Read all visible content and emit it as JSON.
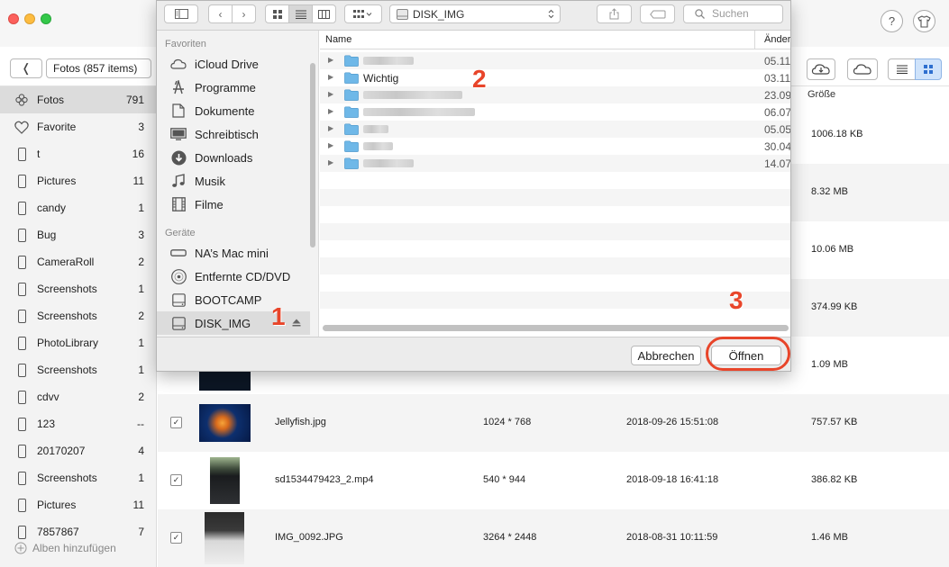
{
  "app": {
    "help_label": "?",
    "album_title": "Fotos (857 items)"
  },
  "sidebar": {
    "items": [
      {
        "label": "Fotos",
        "count": "791",
        "icon": "photos-icon"
      },
      {
        "label": "Favorite",
        "count": "3",
        "icon": "heart-icon"
      },
      {
        "label": "t",
        "count": "16",
        "icon": "phone-icon"
      },
      {
        "label": "Pictures",
        "count": "11",
        "icon": "phone-icon"
      },
      {
        "label": "candy",
        "count": "1",
        "icon": "phone-icon"
      },
      {
        "label": "Bug",
        "count": "3",
        "icon": "phone-icon"
      },
      {
        "label": "CameraRoll",
        "count": "2",
        "icon": "phone-icon"
      },
      {
        "label": "Screenshots",
        "count": "1",
        "icon": "phone-icon"
      },
      {
        "label": "Screenshots",
        "count": "2",
        "icon": "phone-icon"
      },
      {
        "label": "PhotoLibrary",
        "count": "1",
        "icon": "phone-icon"
      },
      {
        "label": "Screenshots",
        "count": "1",
        "icon": "phone-icon"
      },
      {
        "label": "cdvv",
        "count": "2",
        "icon": "phone-icon"
      },
      {
        "label": "123",
        "count": "--",
        "icon": "phone-icon"
      },
      {
        "label": "20170207",
        "count": "4",
        "icon": "phone-icon"
      },
      {
        "label": "Screenshots",
        "count": "1",
        "icon": "phone-icon"
      },
      {
        "label": "Pictures",
        "count": "11",
        "icon": "phone-icon"
      },
      {
        "label": "7857867",
        "count": "7",
        "icon": "phone-icon"
      }
    ],
    "add_album": "Alben hinzufügen"
  },
  "list": {
    "size_header": "Größe",
    "rows": [
      {
        "name": "",
        "resolution": "",
        "date": "",
        "size": "1006.18 KB",
        "checked": false
      },
      {
        "name": "",
        "resolution": "",
        "date": "",
        "size": "8.32 MB",
        "checked": false
      },
      {
        "name": "",
        "resolution": "",
        "date": "",
        "size": "10.06 MB",
        "checked": false
      },
      {
        "name": "",
        "resolution": "",
        "date": "",
        "size": "374.99 KB",
        "checked": false
      },
      {
        "name": "",
        "resolution": "",
        "date": "",
        "size": "1.09 MB",
        "checked": false
      },
      {
        "name": "Jellyfish.jpg",
        "resolution": "1024 * 768",
        "date": "2018-09-26 15:51:08",
        "size": "757.57 KB",
        "checked": true
      },
      {
        "name": "sd1534479423_2.mp4",
        "resolution": "540 * 944",
        "date": "2018-09-18 16:41:18",
        "size": "386.82 KB",
        "checked": true
      },
      {
        "name": "IMG_0092.JPG",
        "resolution": "3264 * 2448",
        "date": "2018-08-31 10:11:59",
        "size": "1.46 MB",
        "checked": true
      }
    ]
  },
  "dialog": {
    "path": "DISK_IMG",
    "search_placeholder": "Suchen",
    "favorites_header": "Favoriten",
    "favorites": [
      {
        "label": "iCloud Drive",
        "icon": "cloud-icon"
      },
      {
        "label": "Programme",
        "icon": "apps-icon"
      },
      {
        "label": "Dokumente",
        "icon": "document-icon"
      },
      {
        "label": "Schreibtisch",
        "icon": "desktop-icon"
      },
      {
        "label": "Downloads",
        "icon": "download-icon"
      },
      {
        "label": "Musik",
        "icon": "music-icon"
      },
      {
        "label": "Filme",
        "icon": "film-icon"
      }
    ],
    "devices_header": "Geräte",
    "devices": [
      {
        "label": "NA’s Mac mini",
        "icon": "computer-icon"
      },
      {
        "label": "Entfernte CD/DVD",
        "icon": "disc-icon"
      },
      {
        "label": "BOOTCAMP",
        "icon": "drive-icon"
      },
      {
        "label": "DISK_IMG",
        "icon": "drive-icon"
      }
    ],
    "col_name": "Name",
    "col_changed": "Änder",
    "files": [
      {
        "name": "",
        "date": "05.11."
      },
      {
        "name": "Wichtig",
        "date": "03.11."
      },
      {
        "name": "",
        "date": "23.09."
      },
      {
        "name": "",
        "date": "06.07."
      },
      {
        "name": "",
        "date": "05.05."
      },
      {
        "name": "",
        "date": "30.04."
      },
      {
        "name": "",
        "date": "14.07."
      }
    ],
    "cancel_label": "Abbrechen",
    "open_label": "Öffnen"
  },
  "annotations": [
    "1",
    "2",
    "3"
  ],
  "colors": {
    "annotation": "#e8452a",
    "folder": "#6fb8e8",
    "selected_toggle": "#cfe3fb"
  }
}
